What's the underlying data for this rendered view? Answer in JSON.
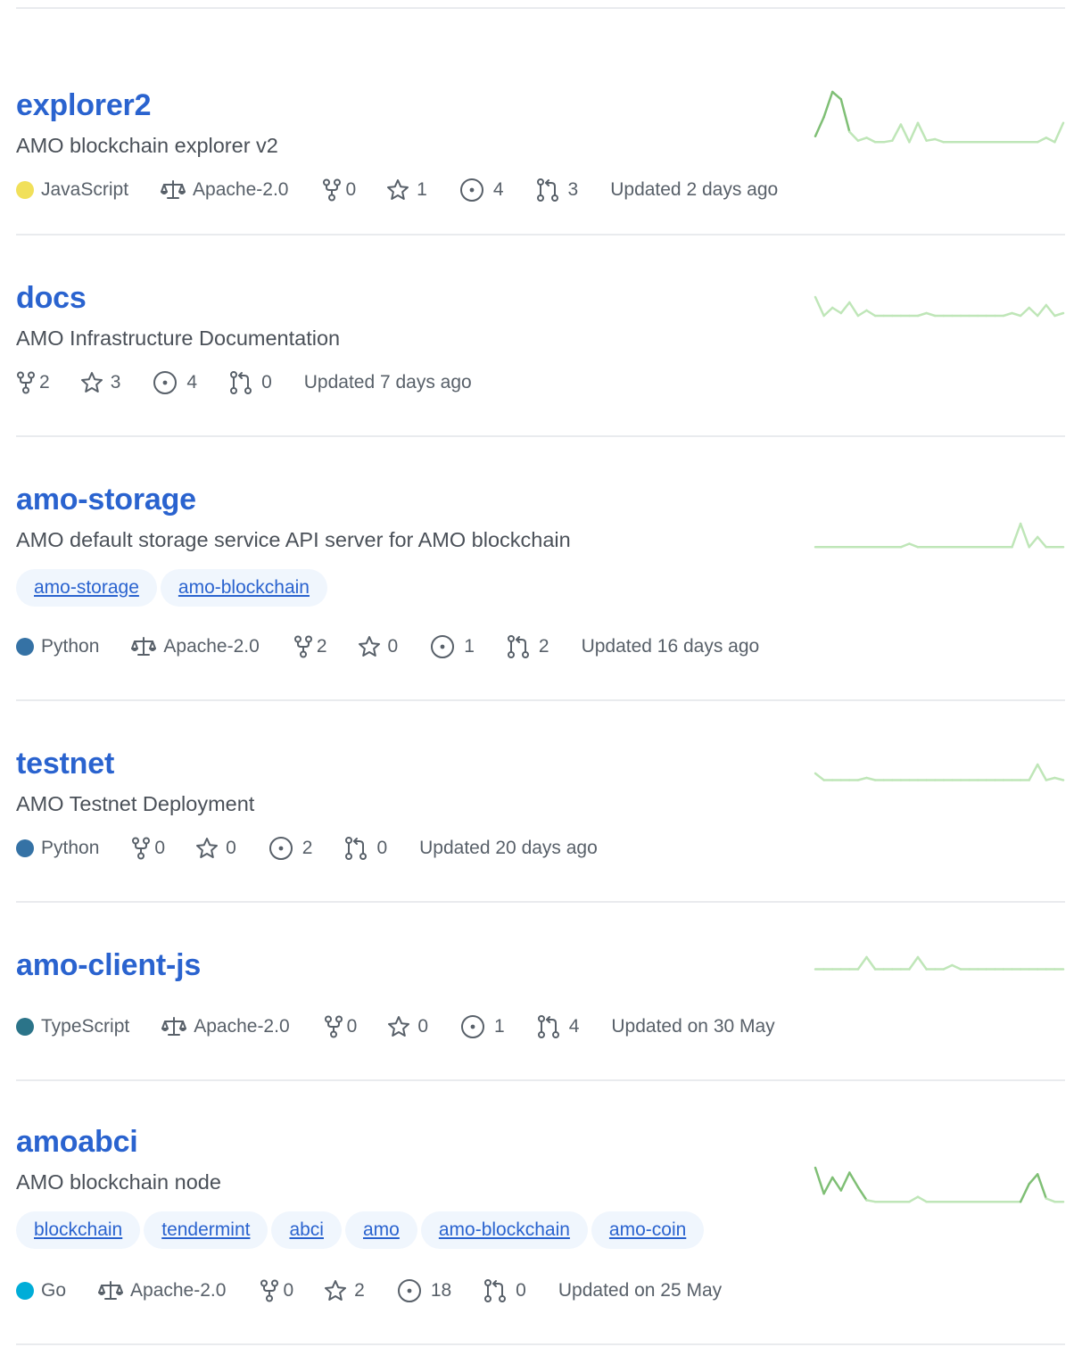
{
  "colors": {
    "link": "#2a63cf",
    "muted": "#586069",
    "topic_bg": "#f0f6fd",
    "spark_light": "#bfe6b8",
    "spark_dark": "#7fbf75",
    "lang_javascript": "#f1e05a",
    "lang_python": "#3572a5",
    "lang_typescript": "#2b7489",
    "lang_go": "#00add8"
  },
  "repos": [
    {
      "name": "explorer2",
      "description": "AMO blockchain explorer v2",
      "language": "JavaScript",
      "license": "Apache-2.0",
      "forks": "0",
      "stars": "1",
      "issues": "4",
      "pulls": "3",
      "updated": "Updated 2 days ago",
      "topics": [],
      "activity": [
        5,
        18,
        35,
        30,
        8,
        2,
        4,
        1,
        1,
        2,
        13,
        1,
        14,
        2,
        3,
        1,
        1,
        1,
        1,
        1,
        1,
        1,
        1,
        1,
        1,
        1,
        1,
        4,
        1,
        14
      ]
    },
    {
      "name": "docs",
      "description": "AMO Infrastructure Documentation",
      "language": "",
      "license": "",
      "forks": "2",
      "stars": "3",
      "issues": "4",
      "pulls": "0",
      "updated": "Updated 7 days ago",
      "topics": [],
      "activity": [
        8,
        1,
        4,
        2,
        6,
        1,
        3,
        1,
        1,
        1,
        1,
        1,
        1,
        2,
        1,
        1,
        1,
        1,
        1,
        1,
        1,
        1,
        1,
        2,
        1,
        4,
        1,
        5,
        1,
        2
      ]
    },
    {
      "name": "amo-storage",
      "description": "AMO default storage service API server for AMO blockchain",
      "language": "Python",
      "license": "Apache-2.0",
      "forks": "2",
      "stars": "0",
      "issues": "1",
      "pulls": "2",
      "updated": "Updated 16 days ago",
      "topics": [
        "amo-storage",
        "amo-blockchain"
      ],
      "activity": [
        1,
        1,
        1,
        1,
        1,
        1,
        1,
        1,
        1,
        1,
        1,
        2,
        1,
        1,
        1,
        1,
        1,
        1,
        1,
        1,
        1,
        1,
        1,
        1,
        8,
        1,
        4,
        1,
        1,
        1
      ]
    },
    {
      "name": "testnet",
      "description": "AMO Testnet Deployment",
      "language": "Python",
      "license": "",
      "forks": "0",
      "stars": "0",
      "issues": "2",
      "pulls": "0",
      "updated": "Updated 20 days ago",
      "topics": [],
      "activity": [
        4,
        1,
        1,
        1,
        1,
        1,
        2,
        1,
        1,
        1,
        1,
        1,
        1,
        1,
        1,
        1,
        1,
        1,
        1,
        1,
        1,
        1,
        1,
        1,
        1,
        1,
        8,
        1,
        2,
        1
      ]
    },
    {
      "name": "amo-client-js",
      "description": "",
      "language": "TypeScript",
      "license": "Apache-2.0",
      "forks": "0",
      "stars": "0",
      "issues": "1",
      "pulls": "4",
      "updated": "Updated on 30 May",
      "topics": [],
      "activity": [
        1,
        1,
        1,
        1,
        1,
        1,
        4,
        1,
        1,
        1,
        1,
        1,
        4,
        1,
        1,
        1,
        2,
        1,
        1,
        1,
        1,
        1,
        1,
        1,
        1,
        1,
        1,
        1,
        1,
        1
      ]
    },
    {
      "name": "amoabci",
      "description": "AMO blockchain node",
      "language": "Go",
      "license": "Apache-2.0",
      "forks": "0",
      "stars": "2",
      "issues": "18",
      "pulls": "0",
      "updated": "Updated on 25 May",
      "topics": [
        "blockchain",
        "tendermint",
        "abci",
        "amo",
        "amo-blockchain",
        "amo-coin"
      ],
      "activity": [
        22,
        6,
        16,
        8,
        19,
        10,
        2,
        1,
        1,
        1,
        1,
        1,
        4,
        1,
        1,
        1,
        1,
        1,
        1,
        1,
        1,
        1,
        1,
        1,
        1,
        12,
        18,
        3,
        1,
        1
      ]
    }
  ]
}
